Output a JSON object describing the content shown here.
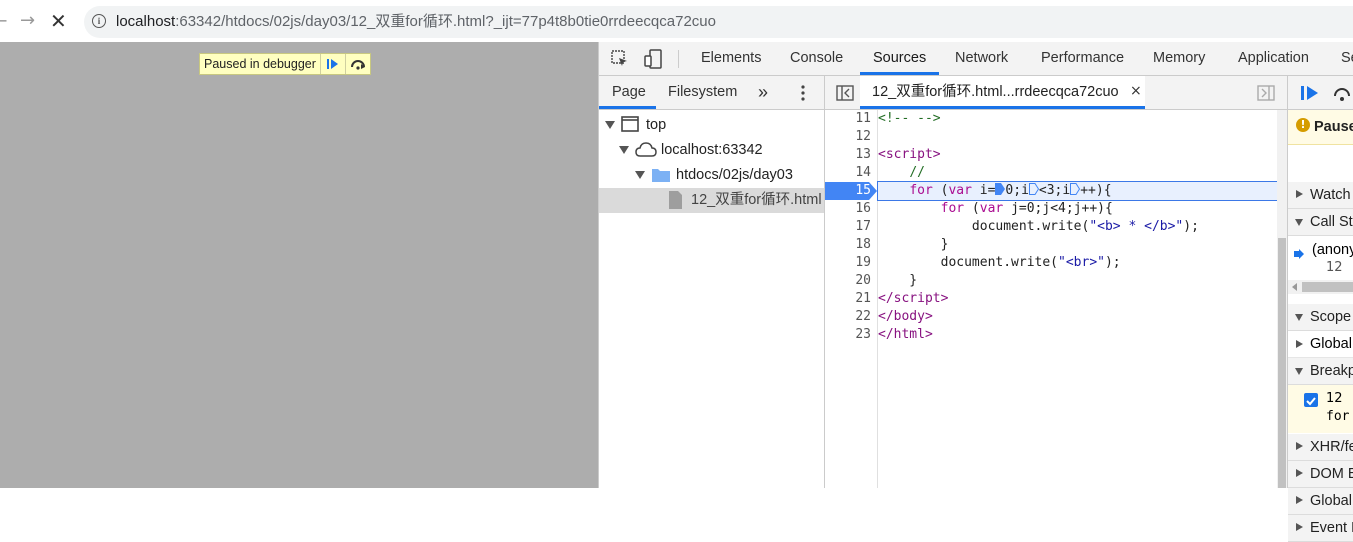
{
  "browser": {
    "url_host": "localhost",
    "url_rest": ":63342/htdocs/02js/day03/12_双重for循环.html?_ijt=77p4t8b0tie0rrdeecqca72cuo",
    "back_icon": "arrow-left-icon",
    "forward_icon": "arrow-right-icon",
    "stop_icon": "close-icon"
  },
  "overlay": {
    "label": "Paused in debugger",
    "resume_icon": "resume-icon",
    "step_over_icon": "step-over-icon"
  },
  "devtools": {
    "tabs": [
      "Elements",
      "Console",
      "Sources",
      "Network",
      "Performance",
      "Memory",
      "Application",
      "Se"
    ],
    "active_tab": "Sources",
    "navigator": {
      "tabs": [
        "Page",
        "Filesystem"
      ],
      "more": "»",
      "tree": [
        {
          "label": "top"
        },
        {
          "label": "localhost:63342"
        },
        {
          "label": "htdocs/02js/day03"
        },
        {
          "label": "12_双重for循环.html"
        }
      ]
    },
    "editor": {
      "file_tab": "12_双重for循环.html...rrdeecqca72cuo",
      "close": "×",
      "line_numbers": [
        "11",
        "12",
        "13",
        "14",
        "15",
        "16",
        "17",
        "18",
        "19",
        "20",
        "21",
        "22",
        "23"
      ]
    },
    "right": {
      "paused_label": "Paused on breakpoint",
      "sections": [
        "Watch",
        "Call Stack",
        "(anonymous)",
        "12",
        "Scope",
        "Global",
        "Breakpoints",
        "12",
        "for",
        "XHR/fetch Breakpoints",
        "DOM Breakpoints",
        "Global Listeners",
        "Event Listener Breakpoints"
      ]
    }
  }
}
